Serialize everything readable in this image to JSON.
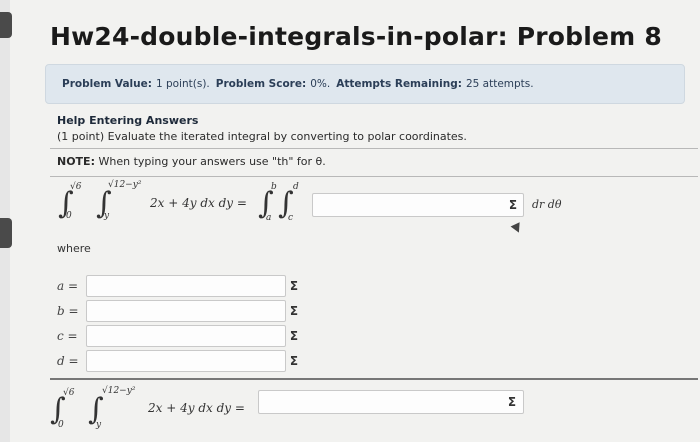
{
  "page": {
    "title": "Hw24-double-integrals-in-polar: Problem 8"
  },
  "info": {
    "value_label": "Problem Value:",
    "value": "1 point(s).",
    "score_label": "Problem Score:",
    "score": "0%.",
    "attempts_label": "Attempts Remaining:",
    "attempts": "25 attempts."
  },
  "problem": {
    "help_link": "Help Entering Answers",
    "prompt": "(1 point) Evaluate the iterated integral by converting to polar coordinates.",
    "note_label": "NOTE:",
    "note_text": "When typing your answers use \"th\" for θ.",
    "where": "where"
  },
  "eq1": {
    "outer_upper": "√6",
    "outer_lower": "0",
    "inner_upper": "√12−y²",
    "inner_lower": "y",
    "integrand": "2x + 4y dx dy =",
    "polar_outer_upper": "b",
    "polar_outer_lower": "a",
    "polar_inner_upper": "d",
    "polar_inner_lower": "c",
    "answer_value": "",
    "suffix": "dr dθ"
  },
  "vars": [
    {
      "label": "a =",
      "value": ""
    },
    {
      "label": "b =",
      "value": ""
    },
    {
      "label": "c =",
      "value": ""
    },
    {
      "label": "d =",
      "value": ""
    }
  ],
  "eq2": {
    "outer_upper": "√6",
    "outer_lower": "0",
    "inner_upper": "√12−y²",
    "inner_lower": "y",
    "integrand": "2x + 4y dx dy =",
    "answer_value": ""
  },
  "icons": {
    "equation_editor": "sigma-icon",
    "pointer": "cursor-icon"
  },
  "sigma_glyph": "Σ"
}
